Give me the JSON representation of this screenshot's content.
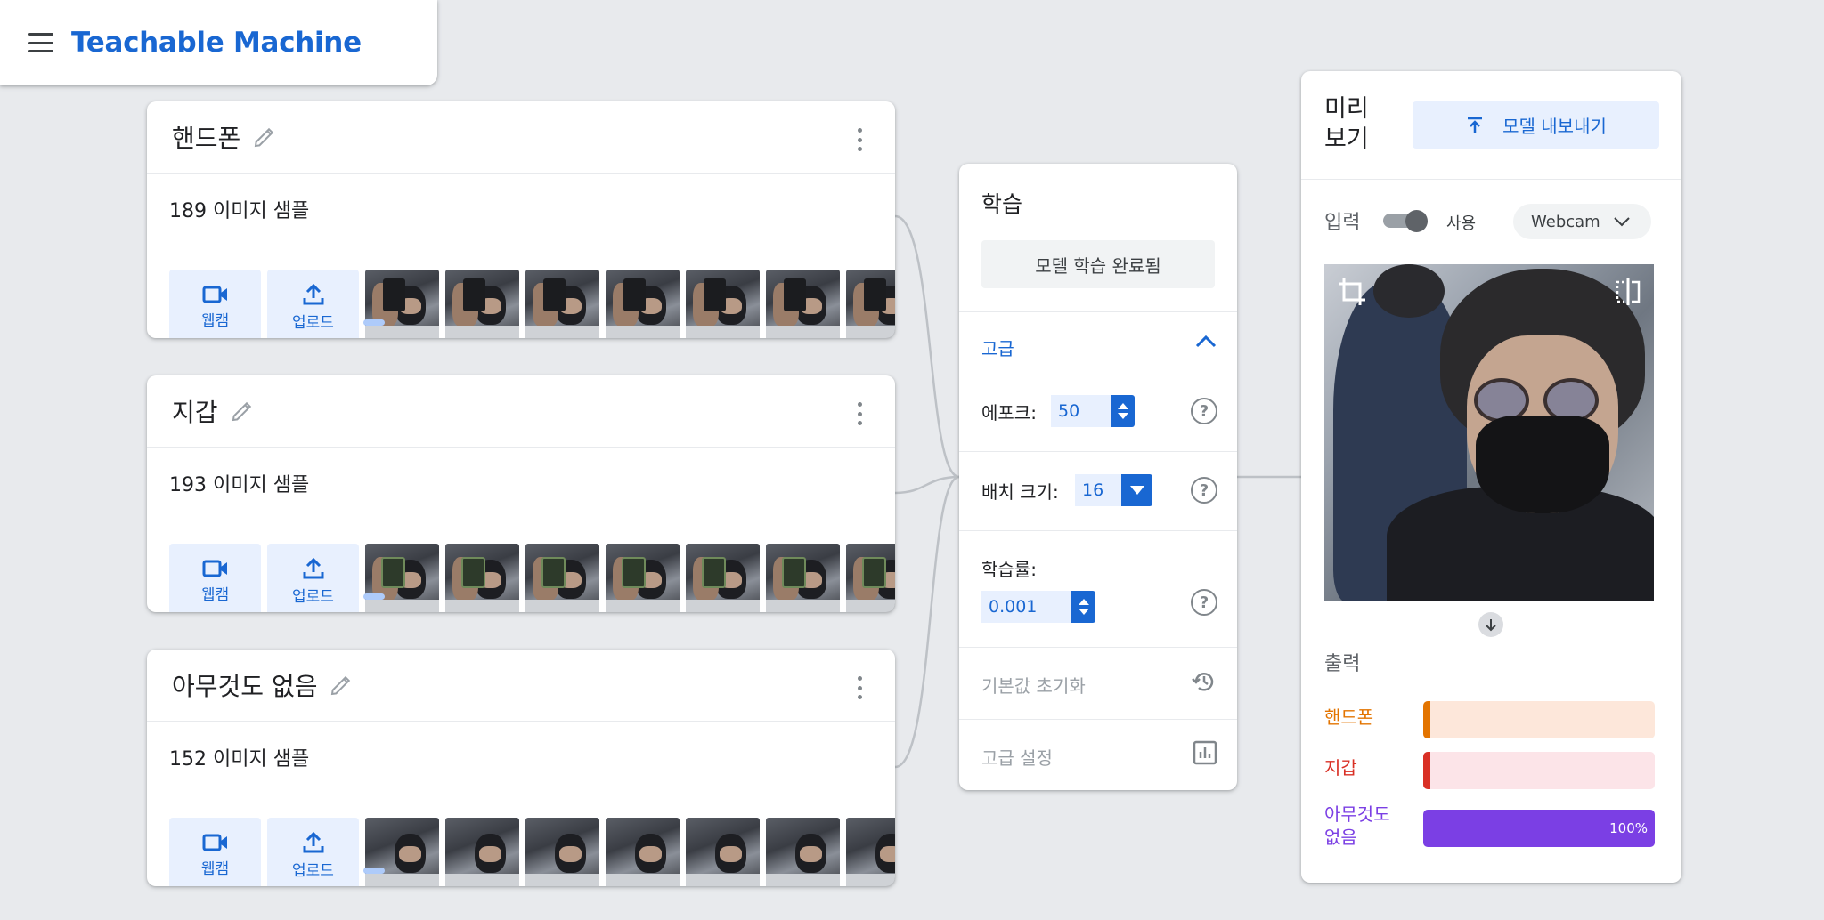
{
  "header": {
    "app_title": "Teachable Machine",
    "menu_icon": "hamburger-menu-icon"
  },
  "classes": [
    {
      "name": "핸드폰",
      "sample_count": "189 이미지 샘플",
      "webcam_label": "웹캠",
      "upload_label": "업로드",
      "thumb_type": "phone"
    },
    {
      "name": "지갑",
      "sample_count": "193 이미지 샘플",
      "webcam_label": "웹캠",
      "upload_label": "업로드",
      "thumb_type": "wallet"
    },
    {
      "name": "아무것도 없음",
      "sample_count": "152 이미지 샘플",
      "webcam_label": "웹캠",
      "upload_label": "업로드",
      "thumb_type": "none"
    }
  ],
  "training": {
    "title": "학습",
    "train_button": "모델 학습 완료됨",
    "advanced_label": "고급",
    "epochs_label": "에포크:",
    "epochs_value": "50",
    "batch_label": "배치 크기:",
    "batch_value": "16",
    "lr_label": "학습률:",
    "lr_value": "0.001",
    "reset_label": "기본값 초기화",
    "advanced_settings_label": "고급 설정"
  },
  "preview": {
    "title": "미리 보기",
    "export_button": "모델 내보내기",
    "input_label": "입력",
    "toggle_label": "사용",
    "toggle_on": true,
    "source_value": "Webcam",
    "output_label": "출력",
    "outputs": [
      {
        "label": "핸드폰",
        "percent": 0,
        "percent_text": "",
        "color": "#e37400",
        "track": "#fde7da"
      },
      {
        "label": "지갑",
        "percent": 0,
        "percent_text": "",
        "color": "#d93025",
        "track": "#fce4e8"
      },
      {
        "label": "아무것도 없음",
        "percent": 100,
        "percent_text": "100%",
        "color": "#7b3fe4",
        "track": "#ede5fc",
        "fill": "#7b3fe4"
      }
    ]
  },
  "colors": {
    "accent": "#1967d2",
    "background": "#e8eaed"
  }
}
